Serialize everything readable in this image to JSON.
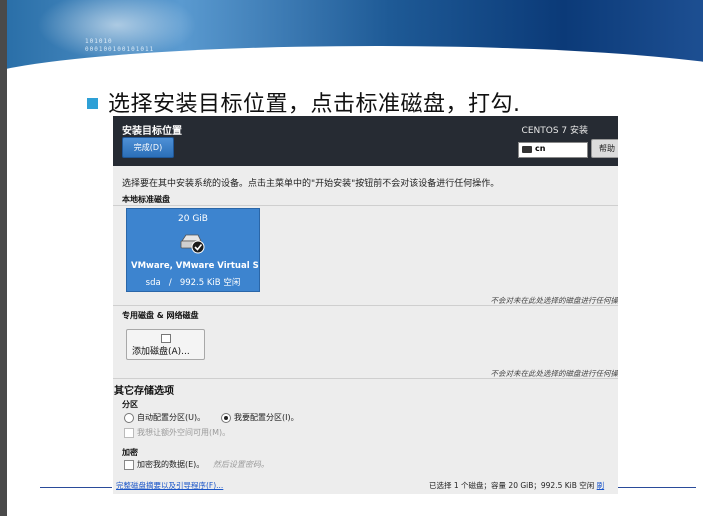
{
  "slide": {
    "banner_digits": [
      "101010",
      "000100100101011"
    ],
    "title": "选择安装目标位置，点击标准磁盘，打勾."
  },
  "window": {
    "title": "安装目标位置",
    "done_label": "完成(D)",
    "product": "CENTOS 7 安装",
    "keyboard_layout": "cn",
    "help_label": "帮助"
  },
  "main": {
    "description": "选择要在其中安装系统的设备。点击主菜单中的\"开始安装\"按钮前不会对该设备进行任何操作。",
    "local_disks_title": "本地标准磁盘",
    "disk": {
      "size": "20 GiB",
      "name": "VMware, VMware Virtual S",
      "device": "sda",
      "separator": "/",
      "free": "992.5 KiB 空闲",
      "selected": true
    },
    "note_local": "不会对未在此处选择的磁盘进行任何操",
    "special_disks_title": "专用磁盘 & 网络磁盘",
    "add_disk_label": "添加磁盘(A)...",
    "note_special": "不会对未在此处选择的磁盘进行任何操",
    "other_options_title": "其它存储选项",
    "partitioning": {
      "title": "分区",
      "auto_label": "自动配置分区(U)。",
      "manual_label": "我要配置分区(I)。",
      "selected": "manual",
      "extra_space_label": "我想让额外空间可用(M)。"
    },
    "encryption": {
      "title": "加密",
      "encrypt_label": "加密我的数据(E)。",
      "hint": "然后设置密码。"
    }
  },
  "footer": {
    "summary_link": "完整磁盘摘要以及引导程序(F)...",
    "status": "已选择 1 个磁盘；容量 20 GiB；992.5 KiB 空闲",
    "trailing": "刷"
  }
}
